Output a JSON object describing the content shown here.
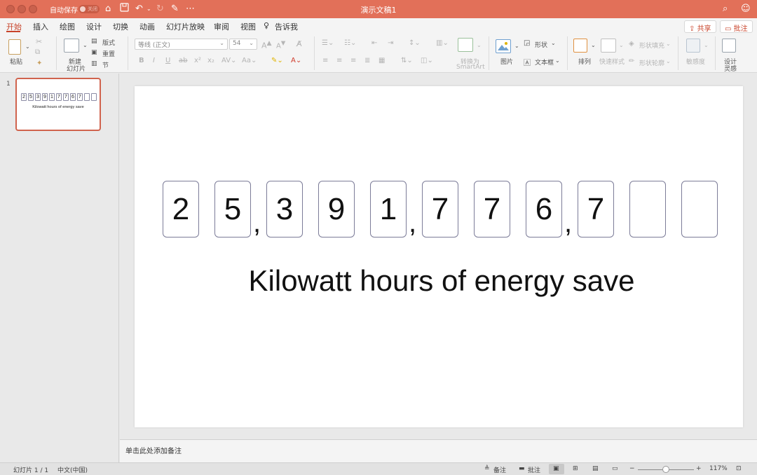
{
  "window": {
    "autosave_label": "自动保存",
    "autosave_state": "关闭",
    "title": "演示文稿1",
    "colors": {
      "titlebar": "#e27059",
      "accent": "#c8432a"
    }
  },
  "menu": {
    "tabs": [
      "开始",
      "插入",
      "绘图",
      "设计",
      "切换",
      "动画",
      "幻灯片放映",
      "审阅",
      "视图",
      "告诉我"
    ],
    "active_tab": "开始",
    "share_label": "共享",
    "comment_label": "批注"
  },
  "ribbon": {
    "paste_label": "粘贴",
    "new_slide_label_1": "新建",
    "new_slide_label_2": "幻灯片",
    "layout_label": "版式",
    "reset_label": "重置",
    "section_label": "节",
    "font_name": "等线 (正文)",
    "font_size": "54",
    "convert_label_1": "转换为",
    "convert_label_2": "SmartArt",
    "picture_label": "图片",
    "shape_label": "形状",
    "textbox_label": "文本框",
    "arrange_label": "排列",
    "quick_styles_label": "快速样式",
    "shape_fill_label": "形状填充",
    "shape_outline_label": "形状轮廓",
    "sensitivity_label": "敏感度",
    "designer_label_1": "设计",
    "designer_label_2": "灵感"
  },
  "thumbnail": {
    "number": "1",
    "digits": [
      "2",
      "5",
      "3",
      "9",
      "1",
      "7",
      "7",
      "6",
      "7",
      "",
      ""
    ],
    "caption": "Kilowatt hours of energy save"
  },
  "slide": {
    "digits": [
      "2",
      "5",
      "3",
      "9",
      "1",
      "7",
      "7",
      "6",
      "7",
      "",
      ""
    ],
    "separator": ",",
    "caption": "Kilowatt hours of energy save"
  },
  "notes": {
    "placeholder": "单击此处添加备注"
  },
  "status": {
    "slide_counter": "幻灯片 1 / 1",
    "language": "中文(中国)",
    "notes_label": "备注",
    "comments_label": "批注",
    "zoom": "117%"
  }
}
